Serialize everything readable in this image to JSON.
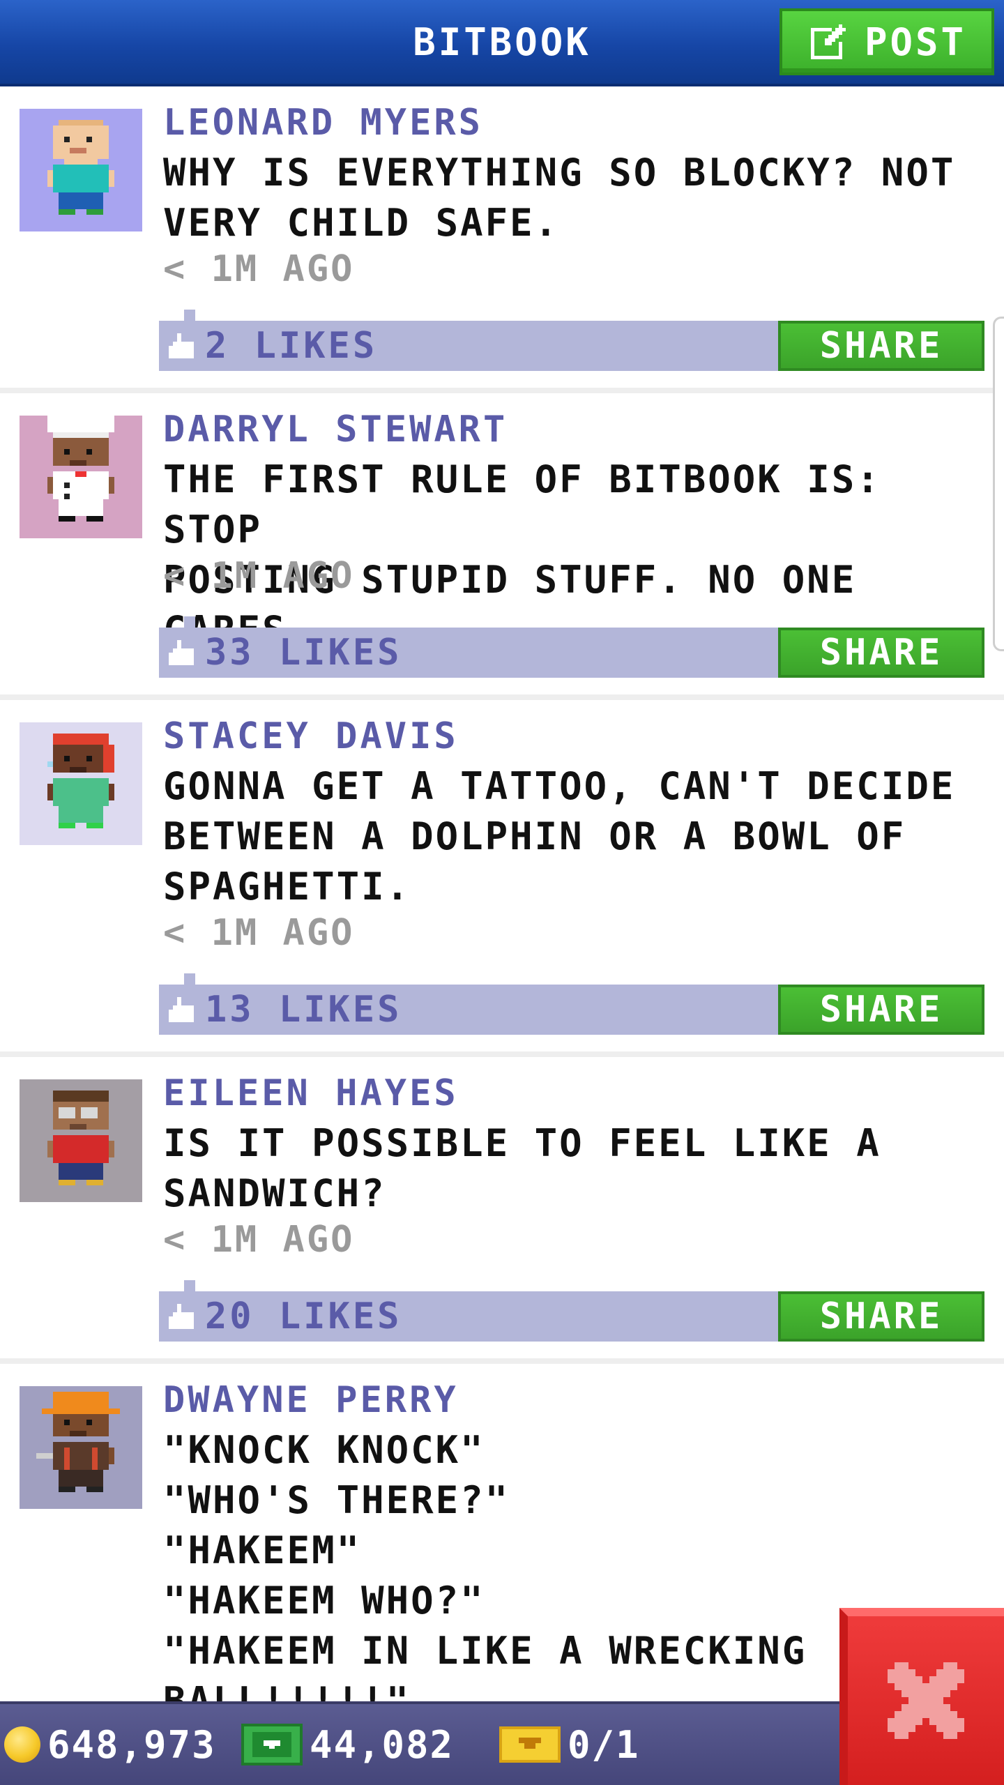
{
  "header": {
    "title": "BITBOOK",
    "post_label": "POST",
    "post_icon": "edit-icon"
  },
  "posts": [
    {
      "author": "LEONARD MYERS",
      "message": "WHY IS EVERYTHING SO BLOCKY? NOT\nVERY CHILD SAFE.",
      "time": "< 1M AGO",
      "likes": "2 LIKES",
      "share_label": "SHARE",
      "avatar_bg": "#a8a4f0",
      "avatar": "bitizen-avatar"
    },
    {
      "author": "DARRYL STEWART",
      "message": "THE FIRST RULE OF BITBOOK IS: STOP\nPOSTING STUPID STUFF. NO ONE CARES.",
      "time": "< 1M AGO",
      "likes": "33 LIKES",
      "share_label": "SHARE",
      "avatar_bg": "#d5a3c3",
      "avatar": "chef-avatar"
    },
    {
      "author": "STACEY DAVIS",
      "message": "GONNA GET A TATTOO, CAN'T DECIDE\nBETWEEN A DOLPHIN OR A BOWL OF\nSPAGHETTI.",
      "time": "< 1M AGO",
      "likes": "13 LIKES",
      "share_label": "SHARE",
      "avatar_bg": "#dddaf0",
      "avatar": "bitizen-avatar"
    },
    {
      "author": "EILEEN HAYES",
      "message": "IS IT POSSIBLE TO FEEL LIKE A\nSANDWICH?",
      "time": "< 1M AGO",
      "likes": "20 LIKES",
      "share_label": "SHARE",
      "avatar_bg": "#a49ea5",
      "avatar": "glasses-avatar"
    },
    {
      "author": "DWAYNE PERRY",
      "message": "\"KNOCK KNOCK\"\n\"WHO'S THERE?\"\n\"HAKEEM\"\n\"HAKEEM WHO?\"\n\"HAKEEM IN LIKE A WRECKING\nBALL!!!!!\"",
      "avatar_bg": "#a09fc0",
      "avatar": "construction-worker-avatar"
    }
  ],
  "footer": {
    "coins": "648,973",
    "bux": "44,082",
    "tickets": "0/1",
    "close_icon": "close-icon"
  },
  "colors": {
    "header_blue": "#1646a6",
    "button_green": "#3cb02b",
    "name_purple": "#5a5ba8",
    "like_bar": "#b3b6d9",
    "close_red": "#d41f1f"
  }
}
